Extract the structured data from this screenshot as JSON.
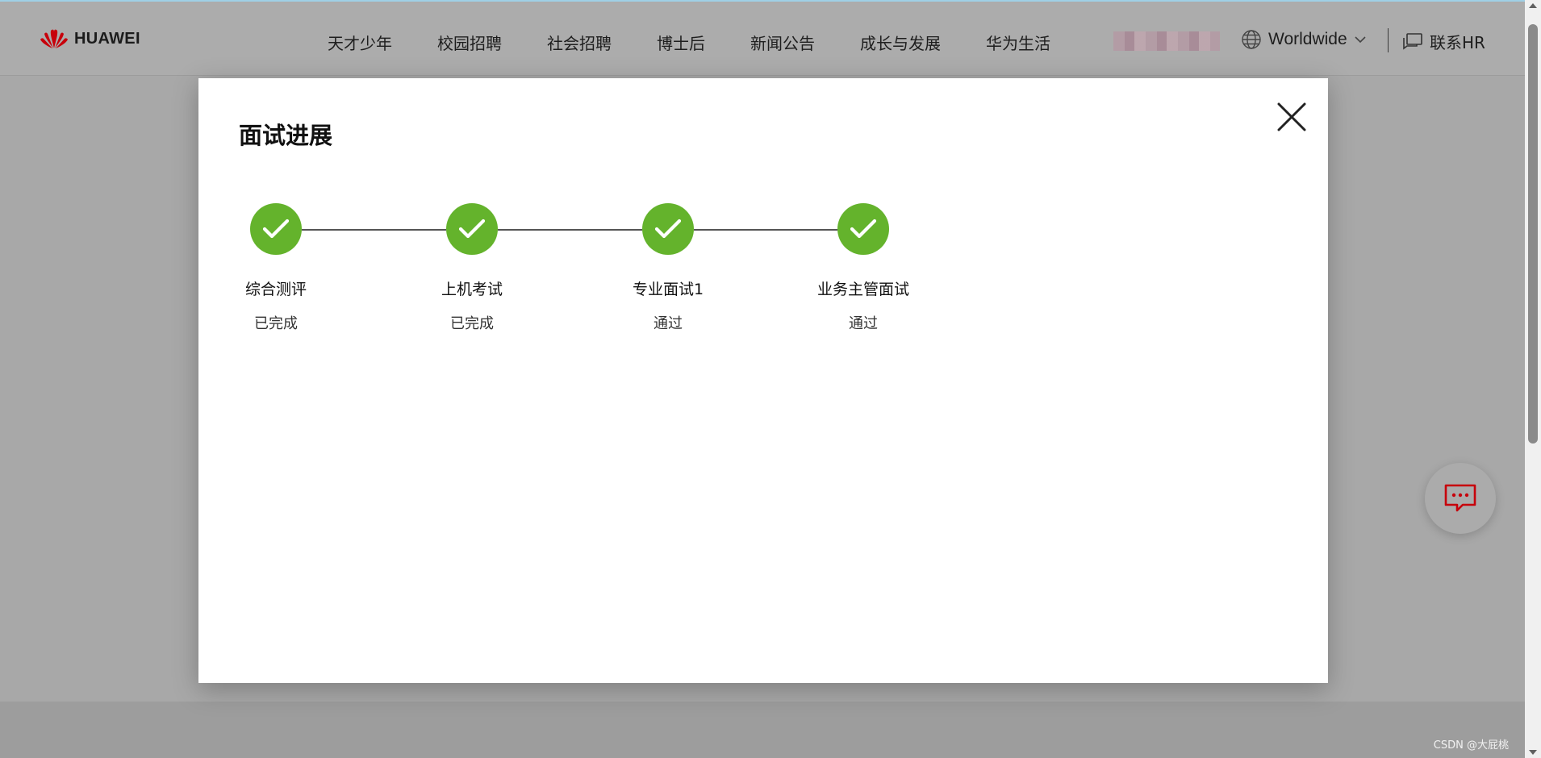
{
  "header": {
    "logo_text": "HUAWEI",
    "nav": [
      "天才少年",
      "校园招聘",
      "社会招聘",
      "博士后",
      "新闻公告",
      "成长与发展",
      "华为生活"
    ],
    "region_label": "Worldwide",
    "contact_label": "联系HR"
  },
  "modal": {
    "title": "面试进展",
    "steps": [
      {
        "name": "综合测评",
        "status": "已完成"
      },
      {
        "name": "上机考试",
        "status": "已完成"
      },
      {
        "name": "专业面试1",
        "status": "通过"
      },
      {
        "name": "业务主管面试",
        "status": "通过"
      }
    ]
  },
  "colors": {
    "step_done": "#64b32c",
    "brand_red": "#c7000b"
  },
  "icons": {
    "close": "close-icon",
    "check": "check-icon",
    "globe": "globe-icon",
    "chat": "chat-icon"
  },
  "watermark": "CSDN @大屁桃"
}
